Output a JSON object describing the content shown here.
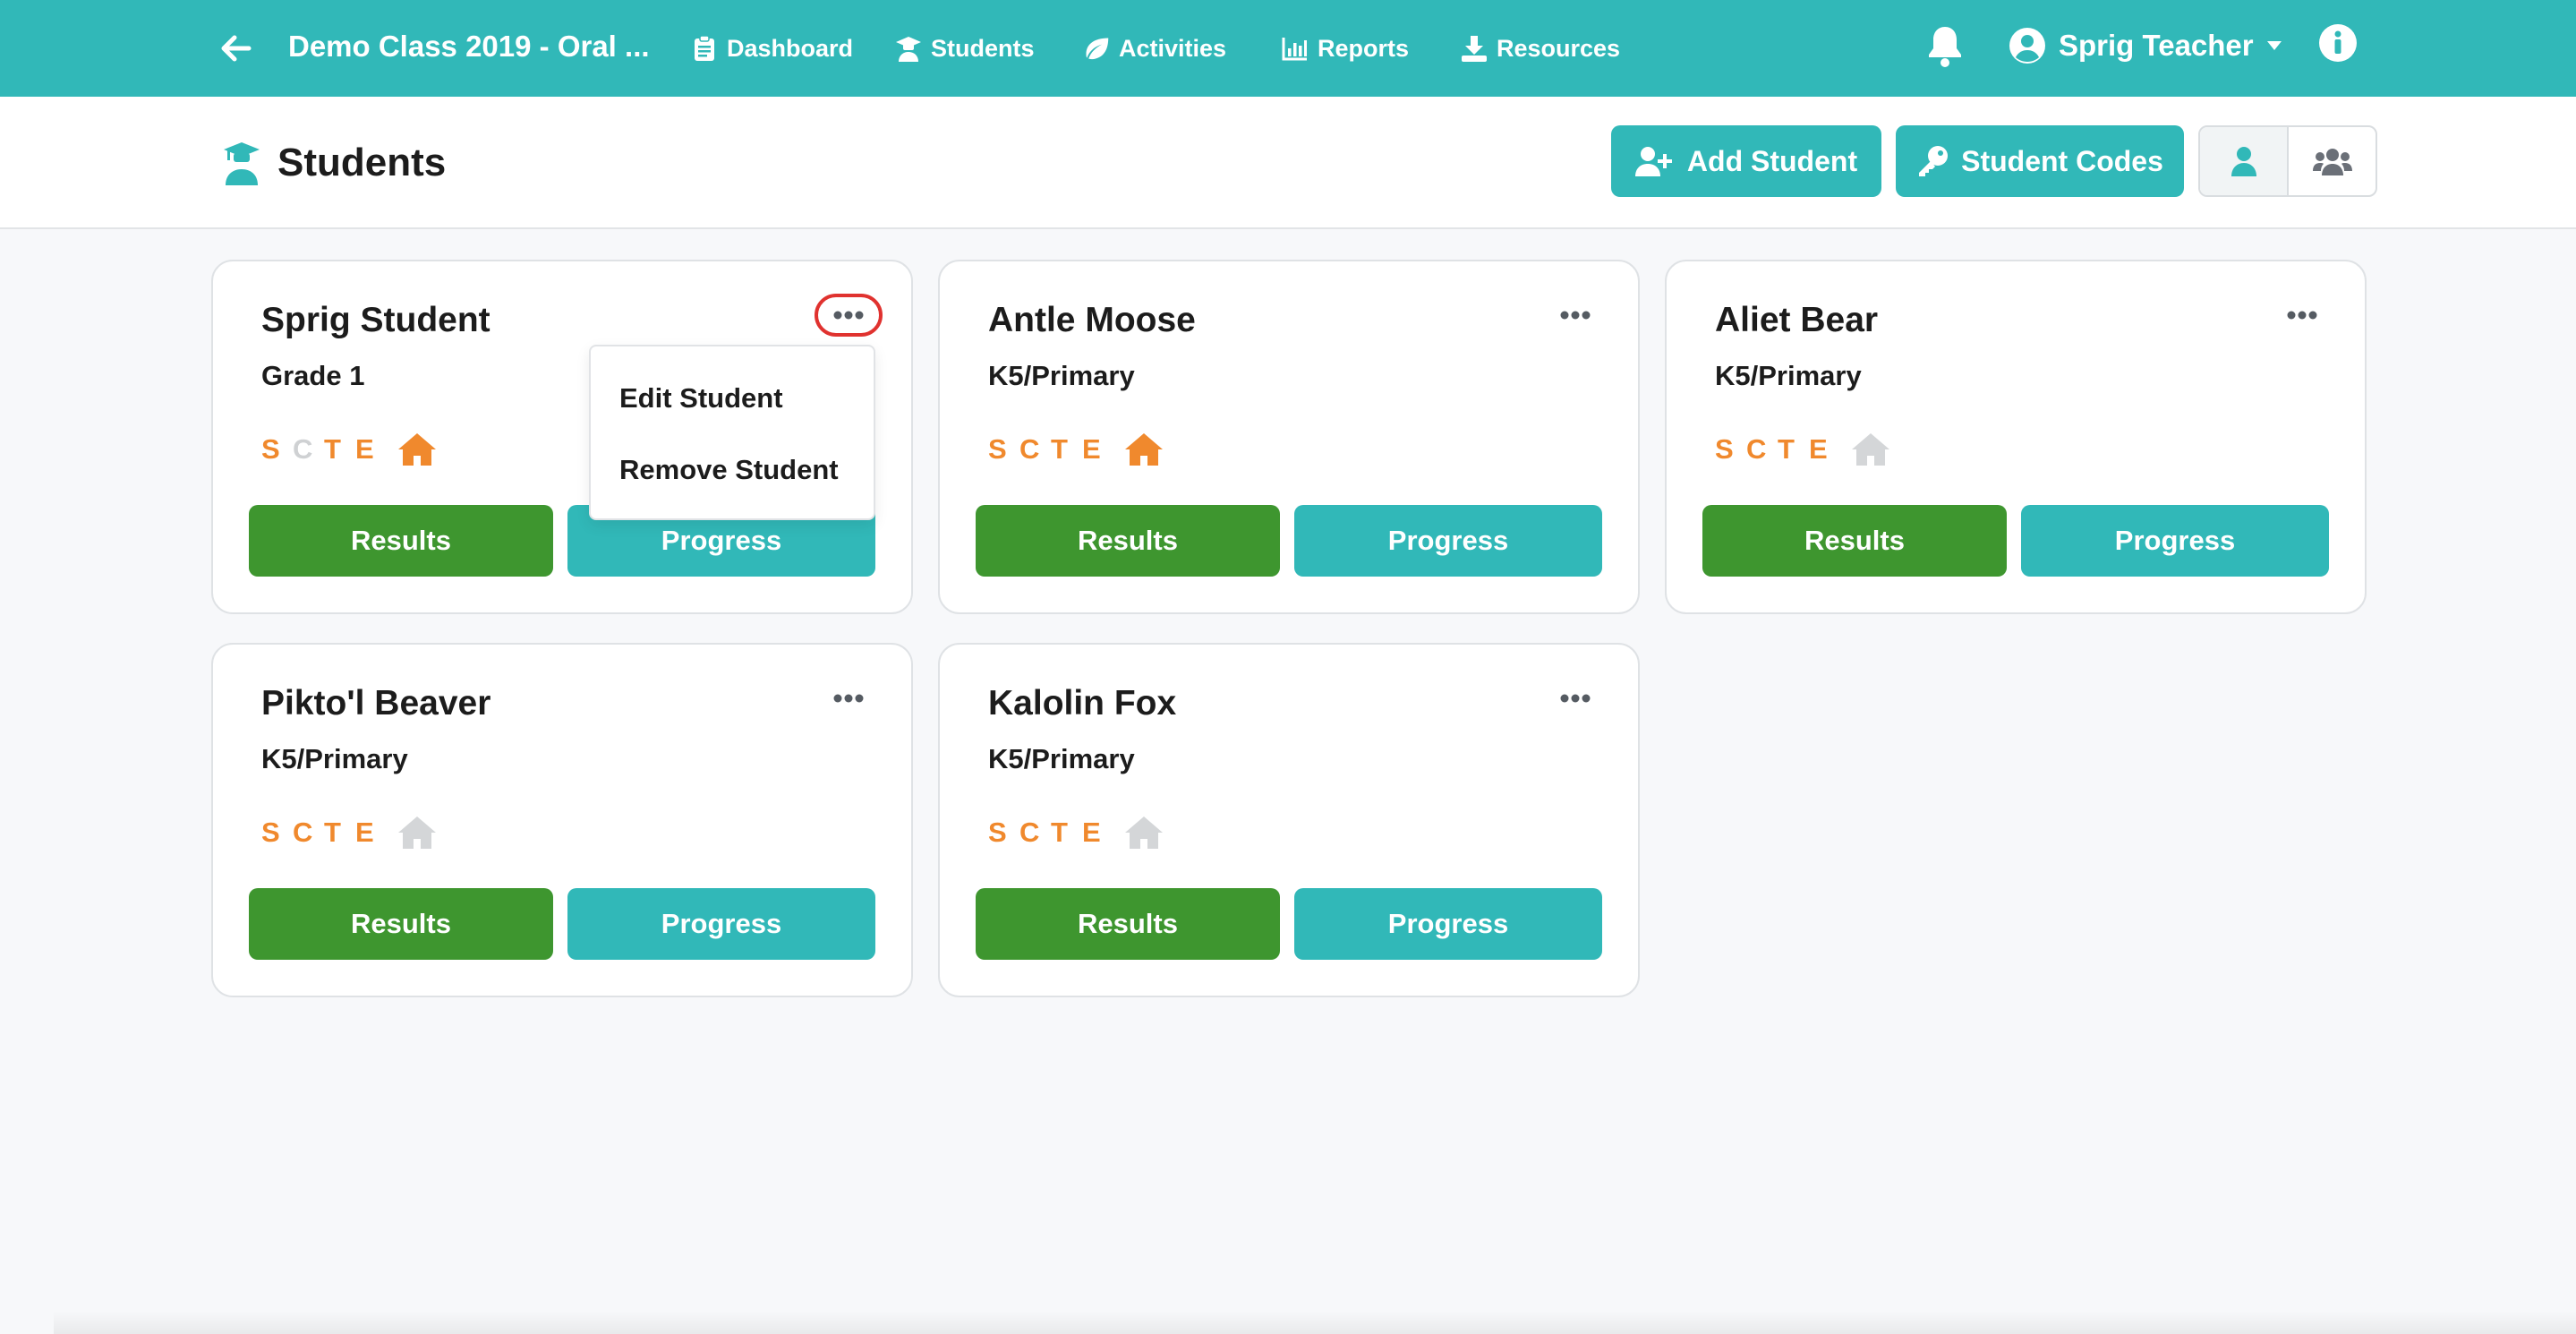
{
  "nav": {
    "class_title": "Demo Class 2019 - Oral ...",
    "links": [
      {
        "label": "Dashboard",
        "icon": "clipboard-icon"
      },
      {
        "label": "Students",
        "icon": "graduate-icon"
      },
      {
        "label": "Activities",
        "icon": "leaf-icon"
      },
      {
        "label": "Reports",
        "icon": "bar-chart-icon"
      },
      {
        "label": "Resources",
        "icon": "download-icon"
      }
    ],
    "user_name": "Sprig Teacher"
  },
  "page": {
    "title": "Students",
    "add_student_label": "Add Student",
    "student_codes_label": "Student Codes"
  },
  "colors": {
    "brand_teal": "#31b8b8",
    "results_green": "#3e962f",
    "scte_on": "#f0892d",
    "scte_off": "#cfd1d3",
    "highlight_red": "#e0322f"
  },
  "students": [
    {
      "name": "Sprig Student",
      "grade": "Grade 1",
      "scte": [
        "S",
        "C",
        "T",
        "E"
      ],
      "scte_active": [
        true,
        false,
        true,
        true
      ],
      "home_active": true
    },
    {
      "name": "Antle Moose",
      "grade": "K5/Primary",
      "scte": [
        "S",
        "C",
        "T",
        "E"
      ],
      "scte_active": [
        true,
        true,
        true,
        true
      ],
      "home_active": true
    },
    {
      "name": "Aliet Bear",
      "grade": "K5/Primary",
      "scte": [
        "S",
        "C",
        "T",
        "E"
      ],
      "scte_active": [
        true,
        true,
        true,
        true
      ],
      "home_active": false
    },
    {
      "name": "Pikto'l Beaver",
      "grade": "K5/Primary",
      "scte": [
        "S",
        "C",
        "T",
        "E"
      ],
      "scte_active": [
        true,
        true,
        true,
        true
      ],
      "home_active": false
    },
    {
      "name": "Kalolin Fox",
      "grade": "K5/Primary",
      "scte": [
        "S",
        "C",
        "T",
        "E"
      ],
      "scte_active": [
        true,
        true,
        true,
        true
      ],
      "home_active": false
    }
  ],
  "card_buttons": {
    "results": "Results",
    "progress": "Progress"
  },
  "dropdown": {
    "edit_label": "Edit Student",
    "remove_label": "Remove Student"
  }
}
